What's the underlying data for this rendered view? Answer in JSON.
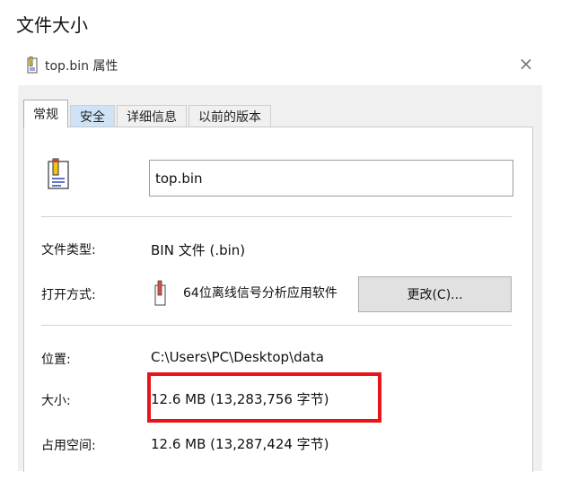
{
  "page": {
    "heading": "文件大小"
  },
  "dialog": {
    "title": "top.bin 属性",
    "close_glyph": "×",
    "tabs": [
      {
        "label": "常规",
        "active": true
      },
      {
        "label": "安全",
        "active": false
      },
      {
        "label": "详细信息",
        "active": false
      },
      {
        "label": "以前的版本",
        "active": false
      }
    ],
    "file_icon": "file-icon",
    "file_name": "top.bin",
    "fields": {
      "type_label": "文件类型:",
      "type_value": "BIN 文件 (.bin)",
      "opens_label": "打开方式:",
      "opens_value": "64位离线信号分析应用软件",
      "opens_icon": "app-icon",
      "change_button": "更改(C)...",
      "location_label": "位置:",
      "location_value": "C:\\Users\\PC\\Desktop\\data",
      "size_label": "大小:",
      "size_value": "12.6 MB (13,283,756 字节)",
      "disk_label": "占用空间:",
      "disk_value": "12.6 MB (13,287,424 字节)"
    },
    "highlight_color": "#e8141b",
    "selected_tab_color": "#cfe3f7"
  }
}
